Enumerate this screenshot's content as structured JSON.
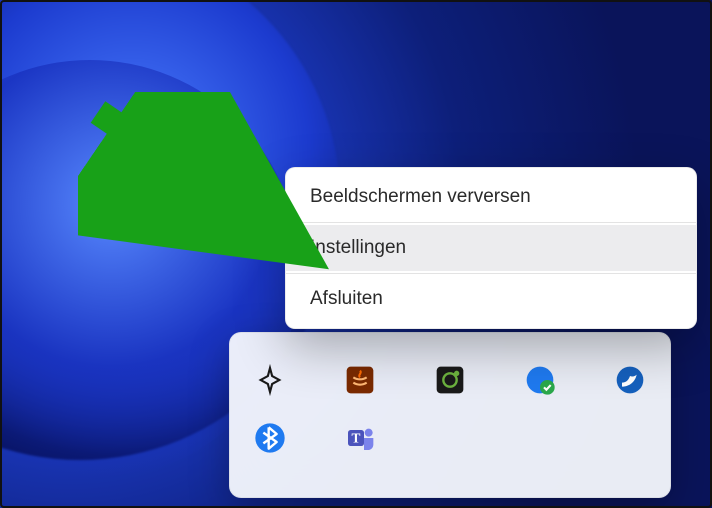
{
  "contextMenu": {
    "items": [
      {
        "label": "Beeldschermen verversen",
        "highlighted": false
      },
      {
        "label": "Instellingen",
        "highlighted": true
      },
      {
        "label": "Afsluiten",
        "highlighted": false
      }
    ]
  },
  "tray": {
    "row1": [
      {
        "name": "sparkle-icon",
        "color": "#1a1a1a"
      },
      {
        "name": "java-icon",
        "color": "#e06c00"
      },
      {
        "name": "dev-tools-icon",
        "color": "#1a1a1a"
      },
      {
        "name": "shield-check-icon",
        "color": "#2aa84a"
      },
      {
        "name": "bird-icon",
        "color": "#1560bd"
      }
    ],
    "row2": [
      {
        "name": "bluetooth-icon",
        "color": "#1f7af0"
      },
      {
        "name": "teams-icon",
        "color": "#4b53bc"
      }
    ]
  },
  "colors": {
    "menuHover": "#ececee",
    "arrow": "#18a118"
  }
}
